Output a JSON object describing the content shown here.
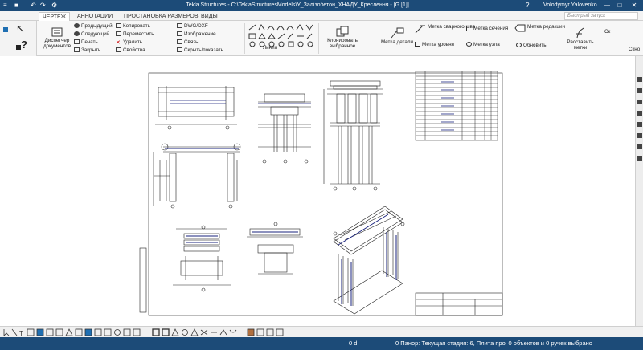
{
  "window": {
    "title": "Tekla Structures - C:\\TeklaStructuresModels\\У_Залізобетон_ХНАДУ_Креслення - [G    [1]]",
    "user": "Volodymyr Yalovenko",
    "help": "?",
    "minimize": "—",
    "maximize": "□",
    "close": "✕"
  },
  "quick_access": {
    "app_menu": "≡",
    "save": "■",
    "undo": "↶",
    "redo": "↷",
    "settings": "⚙"
  },
  "tabs": [
    "ЧЕРТЕЖ",
    "АННОТАЦИИ",
    "ПРОСТАНОВКА РАЗМЕРОВ",
    "ВИДЫ"
  ],
  "active_tab": 0,
  "search": {
    "placeholder": "Быстрый запуск"
  },
  "ribbon": {
    "document_manager": "Диспетчер документов",
    "previous": "Предыдущий",
    "next": "Следующий",
    "print": "Печать",
    "close": "Закрыть",
    "copy": "Копировать",
    "move": "Переместить",
    "delete": "Удалить",
    "properties": "Свойства",
    "dwg_dxf": "DWG/DXF",
    "image": "Изображение",
    "link": "Связь",
    "hide_show": "Скрыть/показать",
    "line": "Линия",
    "clone_selected": "Клонировать выбранное",
    "part_mark": "Метка детали",
    "weld_mark": "Метка сварного шва",
    "level_mark": "Метка уровня",
    "section_mark": "Метка сечения",
    "detail_mark": "Метка узла",
    "revision_mark": "Метка редакции",
    "update": "Обновить",
    "arrange_marks": "Расставить метки",
    "more": "Ск",
    "more2": "Скно"
  },
  "left_panel": {
    "select": "↖",
    "help": "?"
  },
  "status": {
    "coordinates": "0 d",
    "message": "0  Панор: Текущая стадия: 6, Плита проі 0 объектов и 0 ручек выбрано"
  }
}
